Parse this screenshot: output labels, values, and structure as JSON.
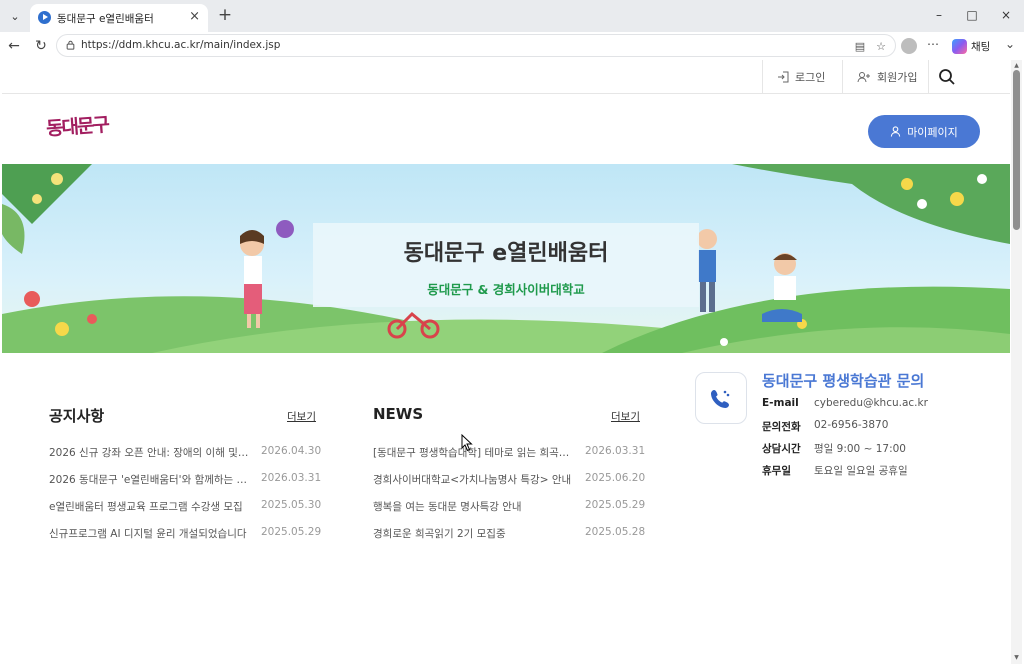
{
  "browser": {
    "tab_title": "동대문구 e열린배움터",
    "url": "https://ddm.khcu.ac.kr/main/index.jsp",
    "chat_label": "채팅"
  },
  "util_bar": {
    "login": "로그인",
    "signup": "회원가입"
  },
  "header": {
    "logo_text": "동대문구",
    "mypage_label": "마이페이지"
  },
  "banner": {
    "title": "동대문구 e열린배움터",
    "subtitle": "동대문구 & 경희사이버대학교"
  },
  "notices": {
    "title": "공지사항",
    "more": "더보기",
    "items": [
      {
        "title": "2026 신규 강좌 오픈 안내: 장애의 이해 및 …",
        "date": "2026.04.30"
      },
      {
        "title": "2026 동대문구 'e열린배움터'와 함께하는 스…",
        "date": "2026.03.31"
      },
      {
        "title": "e열린배움터 평생교육 프로그램 수강생 모집",
        "date": "2025.05.30"
      },
      {
        "title": "신규프로그램 AI 디지털 윤리 개설되었습니다",
        "date": "2025.05.29"
      }
    ]
  },
  "news": {
    "title": "NEWS",
    "more": "더보기",
    "items": [
      {
        "title": "[동대문구 평생학습대학] 테마로 읽는 희곡…",
        "date": "2026.03.31"
      },
      {
        "title": "경희사이버대학교<가치나눔명사 특강> 안내",
        "date": "2025.06.20"
      },
      {
        "title": "행복을 여는 동대문 명사특강 안내",
        "date": "2025.05.29"
      },
      {
        "title": "경희로운 희곡읽기 2기 모집중",
        "date": "2025.05.28"
      }
    ]
  },
  "contact": {
    "title": "동대문구 평생학습관 문의",
    "rows": [
      {
        "label": "E-mail",
        "value": "cyberedu@khcu.ac.kr"
      },
      {
        "label": "문의전화",
        "value": "02-6956-3870"
      },
      {
        "label": "상담시간",
        "value": "평일 9:00 ~ 17:00"
      },
      {
        "label": "휴무일",
        "value": "토요일 일요일 공휴일"
      }
    ]
  },
  "colors": {
    "accent": "#4a78d4",
    "logo": "#a21e60",
    "banner_green": "#1f9a4c"
  }
}
